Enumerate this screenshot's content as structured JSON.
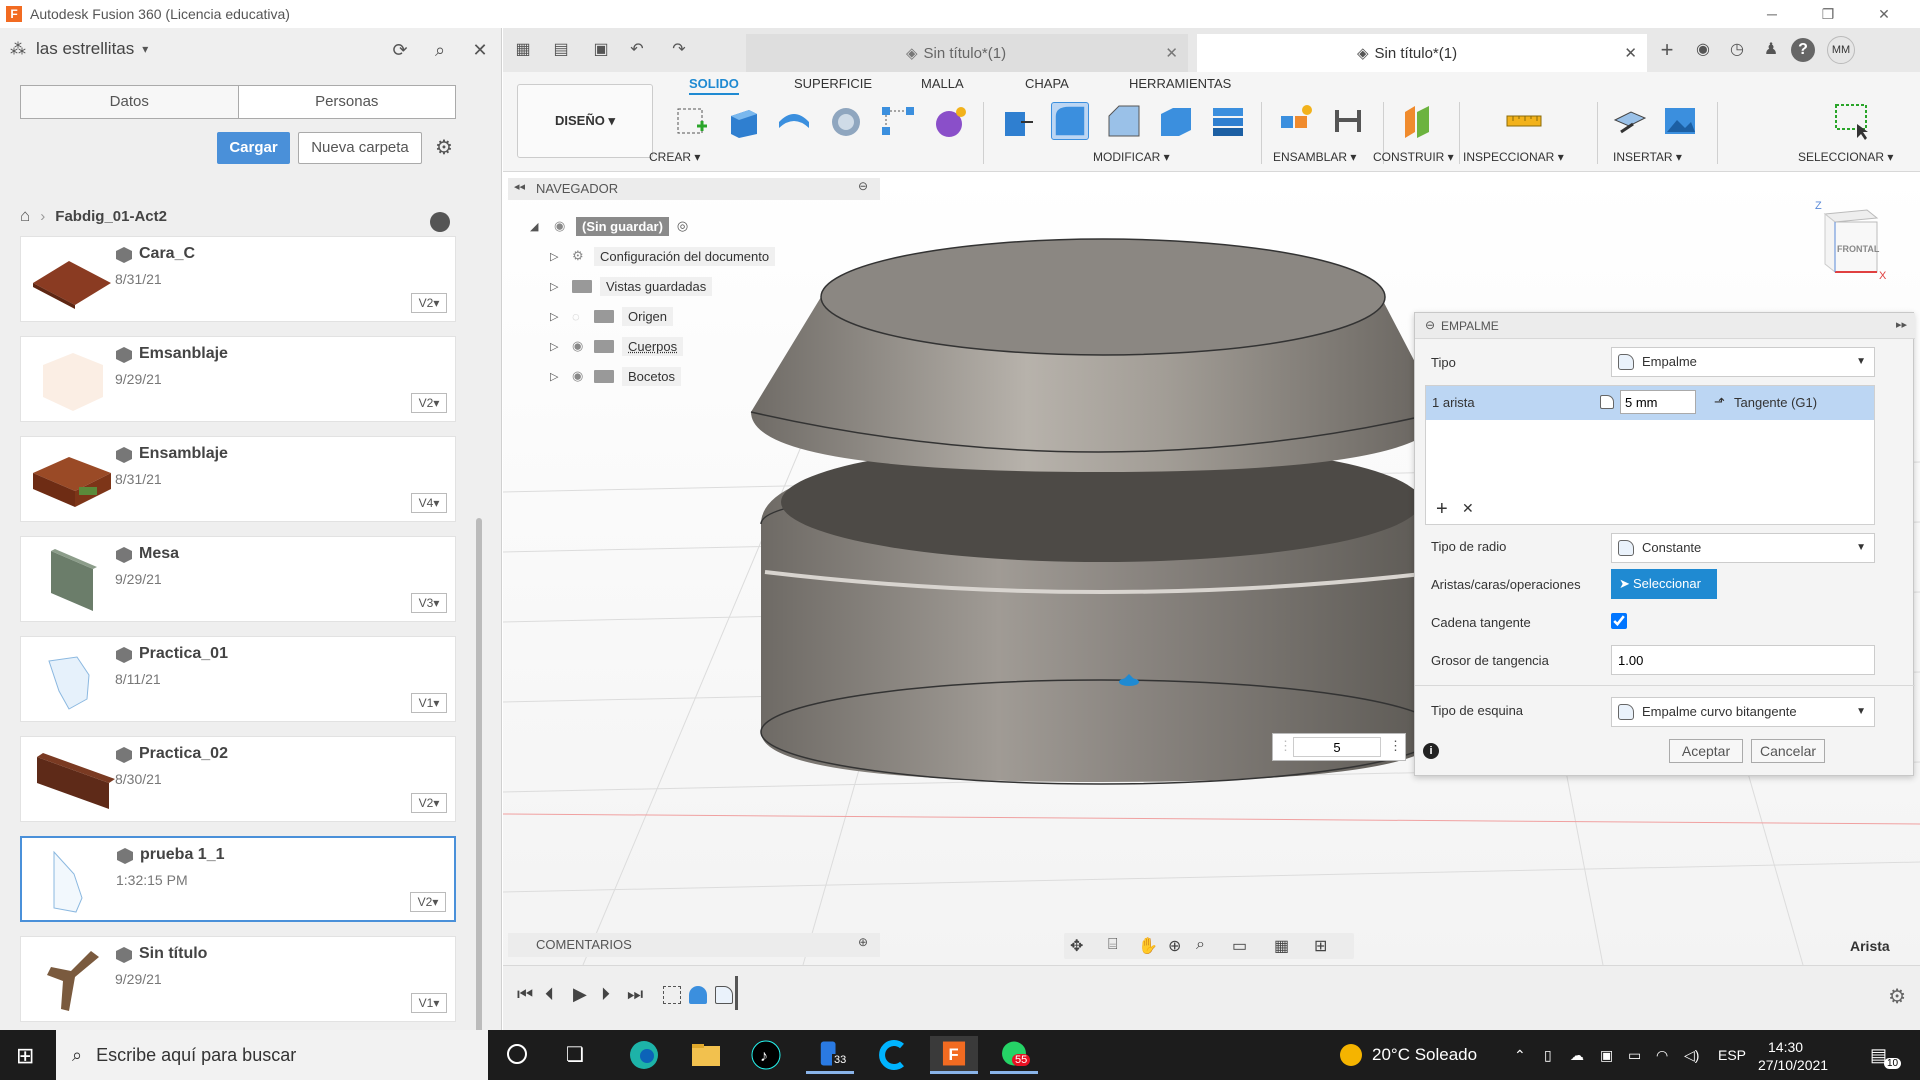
{
  "window": {
    "title": "Autodesk Fusion 360 (Licencia educativa)",
    "logo_letter": "F"
  },
  "data_panel": {
    "team_name": "las estrellitas",
    "tabs": [
      "Datos",
      "Personas"
    ],
    "upload_label": "Cargar",
    "new_folder_label": "Nueva carpeta",
    "breadcrumb": "Fabdig_01-Act2",
    "files": [
      {
        "name": "Cara_C",
        "date": "8/31/21",
        "version": "V2"
      },
      {
        "name": "Emsanblaje",
        "date": "9/29/21",
        "version": "V2"
      },
      {
        "name": "Ensamblaje",
        "date": "8/31/21",
        "version": "V4"
      },
      {
        "name": "Mesa",
        "date": "9/29/21",
        "version": "V3"
      },
      {
        "name": "Practica_01",
        "date": "8/11/21",
        "version": "V1"
      },
      {
        "name": "Practica_02",
        "date": "8/30/21",
        "version": "V2"
      },
      {
        "name": "prueba 1_1",
        "date": "1:32:15 PM",
        "version": "V2"
      },
      {
        "name": "Sin título",
        "date": "9/29/21",
        "version": "V1"
      }
    ]
  },
  "doc_tabs": [
    {
      "label": "Sin título*(1)"
    },
    {
      "label": "Sin título*(1)"
    }
  ],
  "user_initials": "MM",
  "toolbar": {
    "workspace": "DISEÑO",
    "tabs": [
      "SOLIDO",
      "SUPERFICIE",
      "MALLA",
      "CHAPA",
      "HERRAMIENTAS"
    ],
    "groups": [
      "CREAR",
      "MODIFICAR",
      "ENSAMBLAR",
      "CONSTRUIR",
      "INSPECCIONAR",
      "INSERTAR",
      "SELECCIONAR"
    ]
  },
  "navigator": {
    "title": "NAVEGADOR",
    "root": "(Sin guardar)",
    "items": [
      "Configuración del documento",
      "Vistas guardadas",
      "Origen",
      "Cuerpos",
      "Bocetos"
    ]
  },
  "viewcube": {
    "face": "FRONTAL",
    "axis_z": "Z",
    "axis_x": "X"
  },
  "empalme": {
    "title": "EMPALME",
    "tipo_label": "Tipo",
    "tipo_value": "Empalme",
    "edge_label": "1 arista",
    "radius_value": "5 mm",
    "continuity": "Tangente (G1)",
    "add_symbol": "+",
    "remove_symbol": "✕",
    "radio_label": "Tipo de radio",
    "radio_value": "Constante",
    "select_label": "Aristas/caras/operaciones",
    "select_button": "Seleccionar",
    "chain_label": "Cadena tangente",
    "chain_checked": true,
    "weight_label": "Grosor de tangencia",
    "weight_value": "1.00",
    "corner_label": "Tipo de esquina",
    "corner_value": "Empalme curvo bitangente",
    "ok_label": "Aceptar",
    "cancel_label": "Cancelar"
  },
  "edit_field_value": "5",
  "comments_label": "COMENTARIOS",
  "selection_status": "Arista",
  "taskbar": {
    "search_placeholder": "Escribe aquí para buscar",
    "weather": "20°C  Soleado",
    "language": "ESP",
    "time": "14:30",
    "date": "27/10/2021",
    "badge_33": "33",
    "badge_55": "55",
    "notifications": "10"
  }
}
